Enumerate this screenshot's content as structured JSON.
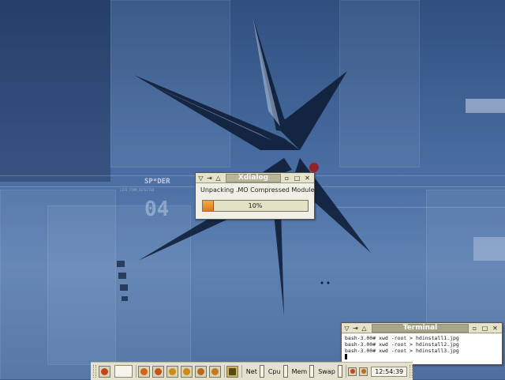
{
  "colors": {
    "desktop": "#3d5d8c",
    "progress_fill": "#e8861c",
    "title_bar": "#e4e2c8"
  },
  "wallpaper": {
    "logo_text": "SP*DER",
    "sub_text": "LIFE_FORM_DETECTED",
    "number_text": "04"
  },
  "xdialog": {
    "title": "Xdialog",
    "message": "Unpacking .MO Compressed Modules...",
    "progress_fraction": 0.1,
    "progress_label": "10%"
  },
  "terminal": {
    "title": "Terminal",
    "lines": [
      "bash-3.00# xwd -root > hdinstall1.jpg",
      "bash-3.00# xwd -root > hdinstall2.jpg",
      "bash-3.00# xwd -root > hdinstall3.jpg"
    ]
  },
  "taskbar": {
    "launchers": [
      {
        "icon": "app-icon",
        "color": "#c4431c"
      },
      {
        "icon": "app-icon",
        "color": "#d6611a"
      },
      {
        "icon": "app-icon",
        "color": "#c0561a"
      },
      {
        "icon": "app-icon",
        "color": "#cc8a18"
      },
      {
        "icon": "app-icon",
        "color": "#d08a14"
      },
      {
        "icon": "app-icon",
        "color": "#b86a20"
      },
      {
        "icon": "app-icon",
        "color": "#c47a18"
      }
    ],
    "monitors": {
      "net": "Net",
      "cpu": "Cpu",
      "mem": "Mem",
      "swap": "Swap"
    },
    "clock": "12:54:39"
  }
}
